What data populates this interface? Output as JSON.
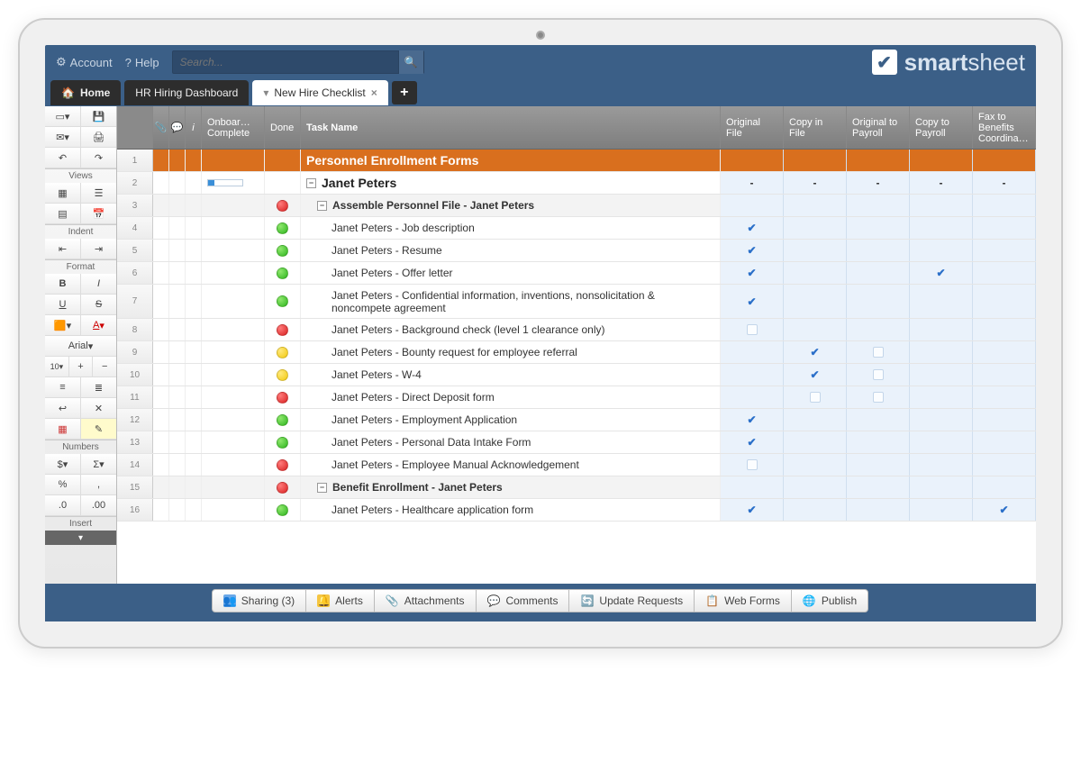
{
  "topbar": {
    "account": "Account",
    "help": "Help",
    "search_placeholder": "Search..."
  },
  "logo": {
    "brand_bold": "smart",
    "brand_light": "sheet"
  },
  "tabs": {
    "home": "Home",
    "hr": "HR Hiring Dashboard",
    "active": "New Hire Checklist"
  },
  "sidebar": {
    "views": "Views",
    "indent": "Indent",
    "format": "Format",
    "numbers": "Numbers",
    "insert": "Insert",
    "font": "Arial",
    "font_size": "10"
  },
  "columns": {
    "onboard": "Onboar… Complete",
    "done": "Done",
    "task": "Task Name",
    "c1": "Original File",
    "c2": "Copy in File",
    "c3": "Original to Payroll",
    "c4": "Copy to Payroll",
    "c5": "Fax to Benefits Coordina…"
  },
  "rows": [
    {
      "n": 1,
      "type": "section",
      "task": "Personnel Enrollment Forms"
    },
    {
      "n": 2,
      "type": "person",
      "task": "Janet Peters",
      "progress": 18,
      "c1": "-",
      "c2": "-",
      "c3": "-",
      "c4": "-",
      "c5": "-"
    },
    {
      "n": 3,
      "type": "group",
      "done": "red",
      "task": "Assemble Personnel File - Janet Peters"
    },
    {
      "n": 4,
      "done": "green",
      "task": "Janet Peters - Job description",
      "c1": "check"
    },
    {
      "n": 5,
      "done": "green",
      "task": "Janet Peters - Resume",
      "c1": "check"
    },
    {
      "n": 6,
      "done": "green",
      "task": "Janet Peters - Offer letter",
      "c1": "check",
      "c4": "check"
    },
    {
      "n": 7,
      "done": "green",
      "task": "Janet Peters - Confidential information, inventions, nonsolicitation & noncompete agreement",
      "c1": "check",
      "tall": true
    },
    {
      "n": 8,
      "done": "red",
      "task": "Janet Peters - Background check (level 1 clearance only)",
      "c1": "box"
    },
    {
      "n": 9,
      "done": "yellow",
      "task": "Janet Peters - Bounty request for employee referral",
      "c2": "check",
      "c3": "box"
    },
    {
      "n": 10,
      "done": "yellow",
      "task": "Janet Peters - W-4",
      "c2": "check",
      "c3": "box"
    },
    {
      "n": 11,
      "done": "red",
      "task": "Janet Peters - Direct Deposit form",
      "c2": "box",
      "c3": "box"
    },
    {
      "n": 12,
      "done": "green",
      "task": "Janet Peters - Employment Application",
      "c1": "check"
    },
    {
      "n": 13,
      "done": "green",
      "task": "Janet Peters - Personal Data Intake Form",
      "c1": "check"
    },
    {
      "n": 14,
      "done": "red",
      "task": "Janet Peters - Employee Manual Acknowledgement",
      "c1": "box"
    },
    {
      "n": 15,
      "type": "group",
      "done": "red",
      "task": "Benefit Enrollment - Janet Peters"
    },
    {
      "n": 16,
      "done": "green",
      "task": "Janet Peters - Healthcare application form",
      "c1": "check",
      "c5": "check"
    }
  ],
  "bottom": {
    "sharing": "Sharing  (3)",
    "alerts": "Alerts",
    "attachments": "Attachments",
    "comments": "Comments",
    "update": "Update Requests",
    "forms": "Web Forms",
    "publish": "Publish"
  }
}
